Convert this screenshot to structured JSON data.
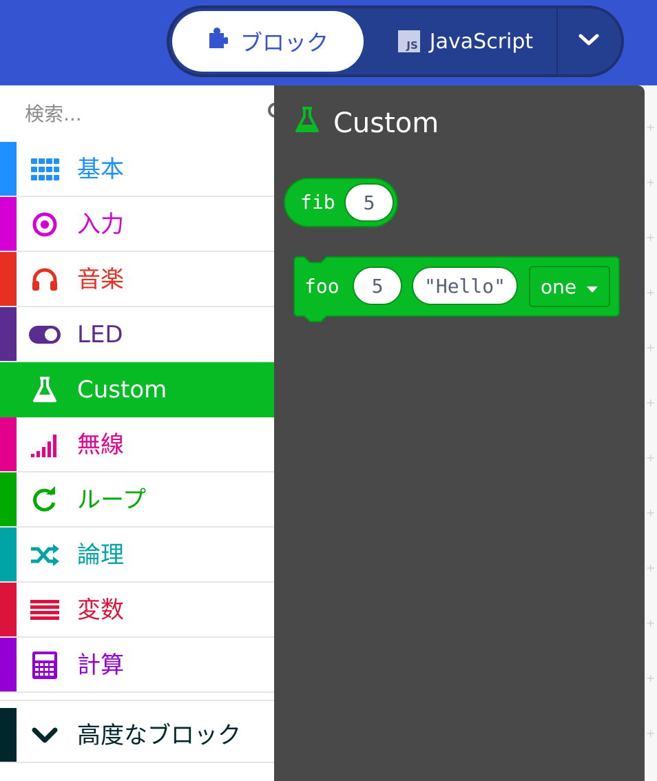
{
  "header": {
    "blocks_label": "ブロック",
    "js_label": "JavaScript",
    "js_logo": "JS"
  },
  "colors": {
    "header_bg": "#3454d1",
    "custom_green": "#06bb24",
    "flyout_bg": "#4a4949"
  },
  "search": {
    "placeholder": "検索..."
  },
  "categories": [
    {
      "id": "basic",
      "label": "基本",
      "color": "#1e90ff",
      "icon": "grid-icon"
    },
    {
      "id": "input",
      "label": "入力",
      "color": "#d400d4",
      "icon": "target-icon"
    },
    {
      "id": "music",
      "label": "音楽",
      "color": "#e63022",
      "icon": "headphones-icon"
    },
    {
      "id": "led",
      "label": "LED",
      "color": "#5c2d91",
      "icon": "toggle-icon"
    },
    {
      "id": "custom",
      "label": "Custom",
      "color": "#06bb24",
      "icon": "flask-icon",
      "selected": true
    },
    {
      "id": "radio",
      "label": "無線",
      "color": "#e3008c",
      "icon": "signal-bars-icon"
    },
    {
      "id": "loops",
      "label": "ループ",
      "color": "#00aa00",
      "icon": "refresh-icon"
    },
    {
      "id": "logic",
      "label": "論理",
      "color": "#00a4a6",
      "icon": "shuffle-icon"
    },
    {
      "id": "variables",
      "label": "変数",
      "color": "#dc143c",
      "icon": "list-lines-icon"
    },
    {
      "id": "math",
      "label": "計算",
      "color": "#9400d3",
      "icon": "calculator-icon"
    }
  ],
  "advanced": {
    "label": "高度なブロック",
    "color": "#00272b"
  },
  "flyout": {
    "title": "Custom",
    "fib_block": {
      "name": "fib",
      "arg": "5"
    },
    "foo_block": {
      "name": "foo",
      "num_arg": "5",
      "str_arg": "\"Hello\"",
      "dropdown_value": "one"
    }
  }
}
